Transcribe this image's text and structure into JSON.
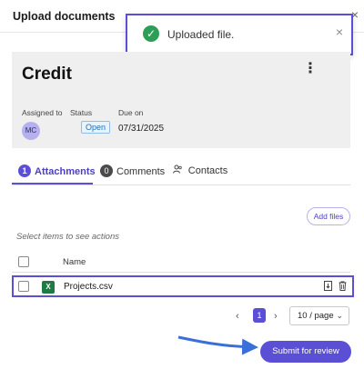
{
  "header": {
    "title": "Upload documents",
    "close_glyph": "×"
  },
  "toast": {
    "message": "Uploaded file.",
    "icon": "check-circle-icon",
    "close_glyph": "×",
    "accent": "#2e9e57"
  },
  "record": {
    "title": "Credit",
    "menu_glyph": "⋮",
    "assigned_label": "Assigned to",
    "assigned_initials": "MC",
    "status_label": "Status",
    "status_value": "Open",
    "due_label": "Due on",
    "due_value": "07/31/2025"
  },
  "tabs": [
    {
      "count": "1",
      "label": "Attachments",
      "active": true
    },
    {
      "count": "0",
      "label": "Comments",
      "active": false
    },
    {
      "icon": "people-icon",
      "label": "Contacts",
      "active": false
    }
  ],
  "add_files_label": "Add files",
  "selection_hint": "Select items to see actions",
  "table": {
    "column_name": "Name",
    "rows": [
      {
        "file_name": "Projects.csv",
        "file_type_icon": "excel-icon",
        "type_badge": "X"
      }
    ]
  },
  "pagination": {
    "current_page": "1",
    "prev_glyph": "‹",
    "next_glyph": "›",
    "page_size": "10 / page",
    "page_size_chevron": "⌄"
  },
  "submit_label": "Submit for review",
  "colors": {
    "accent": "#5b4fd6",
    "highlight_border": "#5b4fd6",
    "arrow": "#3b6fd8"
  }
}
